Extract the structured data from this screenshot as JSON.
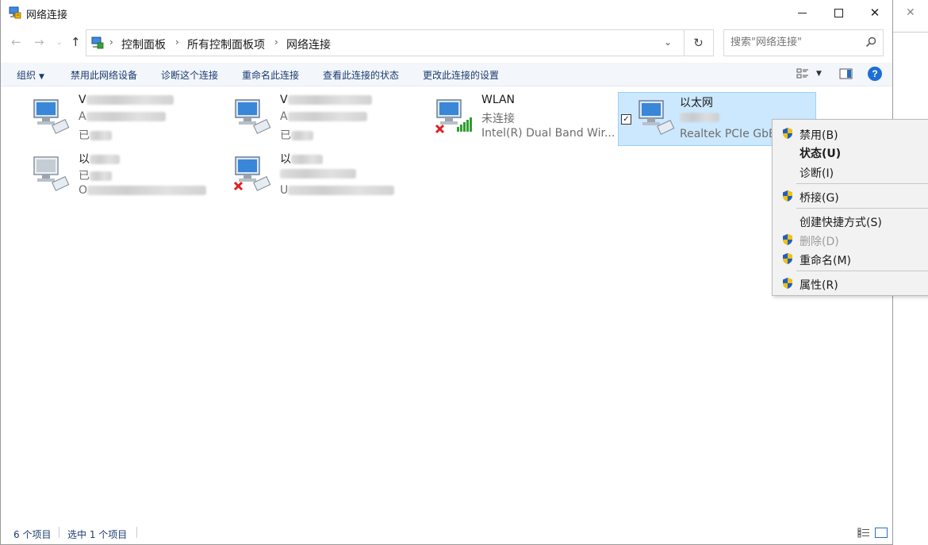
{
  "window": {
    "title": "网络连接"
  },
  "address": {
    "crumbs": [
      "控制面板",
      "所有控制面板项",
      "网络连接"
    ]
  },
  "search": {
    "placeholder": "搜索\"网络连接\""
  },
  "commands": {
    "organize": "组织",
    "disable_device": "禁用此网络设备",
    "diagnose": "诊断这个连接",
    "rename": "重命名此连接",
    "view_status": "查看此连接的状态",
    "change_settings": "更改此连接的设置"
  },
  "connections": [
    {
      "name": "V",
      "status": "A",
      "device": "已",
      "disconnected": false,
      "selected": false
    },
    {
      "name": "V",
      "status": "A",
      "device": "已",
      "disconnected": false,
      "selected": false
    },
    {
      "name": "WLAN",
      "status": "未连接",
      "device": "Intel(R) Dual Band Wir...",
      "disconnected": true,
      "wireless": true,
      "selected": false
    },
    {
      "name": "以太网",
      "status": "",
      "device": "Realtek PCIe GbE",
      "disconnected": false,
      "selected": true
    },
    {
      "name": "以",
      "status": "已",
      "device": "O",
      "disconnected": false,
      "selected": false
    },
    {
      "name": "以",
      "status": "",
      "device": "U",
      "disconnected": true,
      "selected": false
    }
  ],
  "context_menu": {
    "items": [
      {
        "label": "禁用(B)",
        "shield": true,
        "bold": false,
        "disabled": false
      },
      {
        "label": "状态(U)",
        "shield": false,
        "bold": true,
        "disabled": false
      },
      {
        "label": "诊断(I)",
        "shield": false,
        "bold": false,
        "disabled": false
      },
      {
        "label": "桥接(G)",
        "shield": true,
        "bold": false,
        "disabled": false
      },
      {
        "label": "创建快捷方式(S)",
        "shield": false,
        "bold": false,
        "disabled": false
      },
      {
        "label": "删除(D)",
        "shield": true,
        "bold": false,
        "disabled": true
      },
      {
        "label": "重命名(M)",
        "shield": true,
        "bold": false,
        "disabled": false
      },
      {
        "label": "属性(R)",
        "shield": true,
        "bold": false,
        "disabled": false
      }
    ]
  },
  "statusbar": {
    "count": "6 个项目",
    "selected": "选中 1 个项目"
  },
  "colors": {
    "accent": "#1d6fd6",
    "selection": "#cce8ff",
    "command_text": "#1b3b6f",
    "error_red": "#e02020"
  }
}
